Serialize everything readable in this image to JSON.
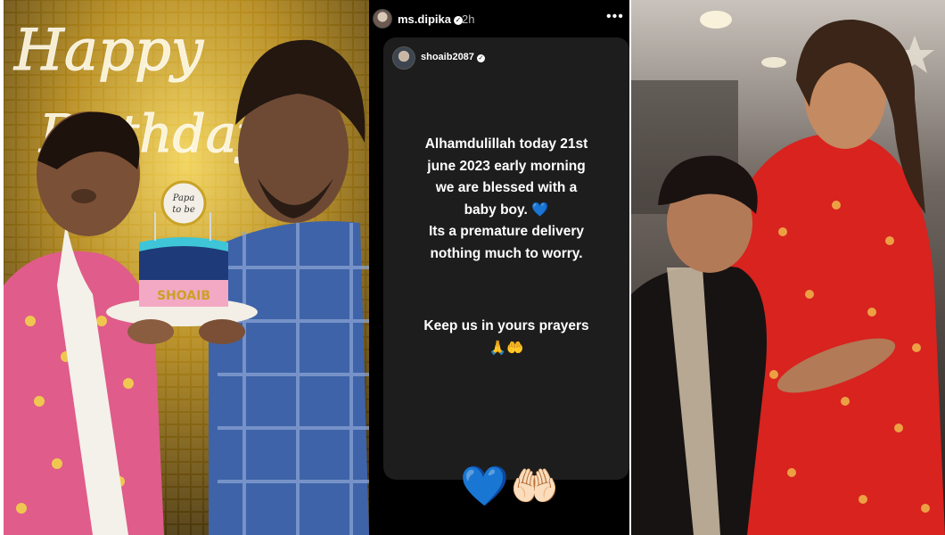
{
  "story": {
    "username": "ms.dipika",
    "time": "2h",
    "more_icon": "more-horizontal-icon",
    "verified_icon": "verified-badge-icon"
  },
  "shared_post": {
    "username": "shoaib2087",
    "verified_icon": "verified-badge-icon",
    "lines": [
      "Alhamdulillah today 21st",
      "june 2023 early morning",
      "we are blessed with a",
      "baby boy. 💙",
      "Its a premature delivery",
      "nothing much to worry."
    ],
    "closing_lines": [
      "Keep us in yours prayers",
      "🙏🤲"
    ]
  },
  "reactions": {
    "heart": "💙",
    "hands": "🤲🏻"
  },
  "left_photo": {
    "sign_line_1": "Happy",
    "sign_line_2": "Birthday",
    "cake_topper_line_1": "Papa",
    "cake_topper_line_2": "to be",
    "cake_name": "SHOAIB"
  },
  "colors": {
    "story_bg": "#000000",
    "card_bg": "#1d1d1d",
    "heart_blue": "#1f6fe0",
    "backdrop_gold": "#c9a227",
    "dress_red": "#d8231f",
    "kurta_pink": "#e05c8a",
    "shirt_blue": "#3f63a8"
  }
}
